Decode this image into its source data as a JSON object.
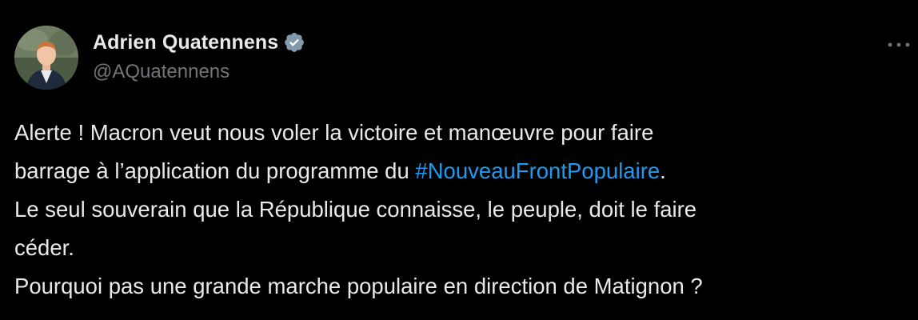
{
  "author": {
    "display_name": "Adrien Quatennens",
    "handle": "@AQuatennens",
    "verified": true,
    "avatar_icon": "profile-photo"
  },
  "menu": {
    "icon": "more-options-icon"
  },
  "tweet": {
    "line1": "Alerte ! Macron veut nous voler la victoire et manœuvre pour faire",
    "line2_before": "barrage à l’application du programme du ",
    "hashtag": "#NouveauFrontPopulaire",
    "line2_after": ".",
    "line3": "Le seul souverain que la République connaisse, le peuple, doit le faire",
    "line4": "céder.",
    "line5": "Pourquoi pas une grande marche populaire en direction de Matignon ?"
  },
  "colors": {
    "background": "#000000",
    "text": "#e7e9ea",
    "muted": "#71767b",
    "link": "#1d9bf0",
    "verified_badge": "#829aab"
  }
}
